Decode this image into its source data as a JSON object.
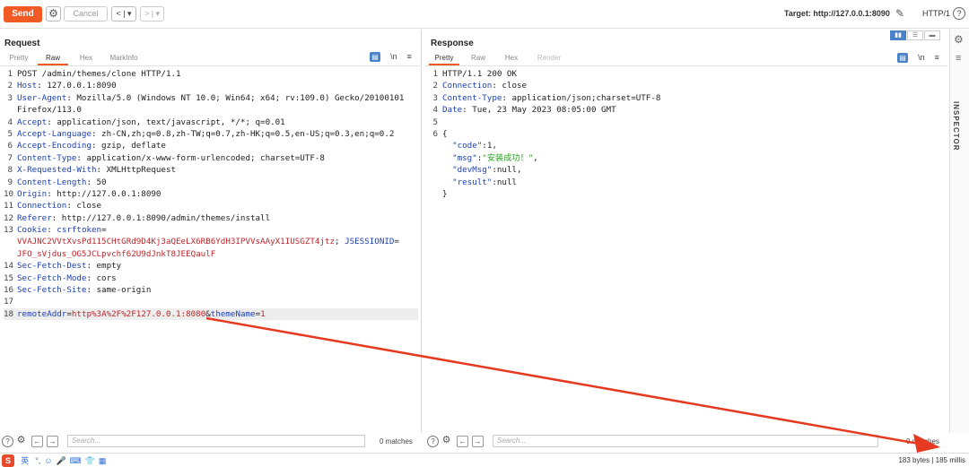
{
  "toolbar": {
    "send": "Send",
    "cancel": "Cancel",
    "back": "< | ▾",
    "forward": "> | ▾",
    "target": "Target: http://127.0.0.1:8090",
    "protocol": "HTTP/1",
    "help": "?",
    "gear": "⚙",
    "edit": "✎"
  },
  "request": {
    "title": "Request",
    "tabs": [
      "Pretty",
      "Raw",
      "Hex",
      "MarkInfo"
    ],
    "active_tab": "Raw",
    "tools": [
      "\\n",
      "≡"
    ],
    "lines": [
      {
        "n": "1",
        "parts": [
          [
            "v",
            "POST /admin/themes/clone HTTP/1.1"
          ]
        ]
      },
      {
        "n": "2",
        "parts": [
          [
            "k",
            "Host"
          ],
          [
            "v",
            ": 127.0.0.1:8090"
          ]
        ]
      },
      {
        "n": "3",
        "parts": [
          [
            "k",
            "User-Agent"
          ],
          [
            "v",
            ": Mozilla/5.0 (Windows NT 10.0; Win64; x64; rv:109.0) Gecko/20100101"
          ]
        ]
      },
      {
        "n": "",
        "parts": [
          [
            "v",
            "Firefox/113.0"
          ]
        ]
      },
      {
        "n": "4",
        "parts": [
          [
            "k",
            "Accept"
          ],
          [
            "v",
            ": application/json, text/javascript, */*; q=0.01"
          ]
        ]
      },
      {
        "n": "5",
        "parts": [
          [
            "k",
            "Accept-Language"
          ],
          [
            "v",
            ": zh-CN,zh;q=0.8,zh-TW;q=0.7,zh-HK;q=0.5,en-US;q=0.3,en;q=0.2"
          ]
        ]
      },
      {
        "n": "6",
        "parts": [
          [
            "k",
            "Accept-Encoding"
          ],
          [
            "v",
            ": gzip, deflate"
          ]
        ]
      },
      {
        "n": "7",
        "parts": [
          [
            "k",
            "Content-Type"
          ],
          [
            "v",
            ": application/x-www-form-urlencoded; charset=UTF-8"
          ]
        ]
      },
      {
        "n": "8",
        "parts": [
          [
            "k",
            "X-Requested-With"
          ],
          [
            "v",
            ": XMLHttpRequest"
          ]
        ]
      },
      {
        "n": "9",
        "parts": [
          [
            "k",
            "Content-Length"
          ],
          [
            "v",
            ": 50"
          ]
        ]
      },
      {
        "n": "10",
        "parts": [
          [
            "k",
            "Origin"
          ],
          [
            "v",
            ": http://127.0.0.1:8090"
          ]
        ]
      },
      {
        "n": "11",
        "parts": [
          [
            "k",
            "Connection"
          ],
          [
            "v",
            ": close"
          ]
        ]
      },
      {
        "n": "12",
        "parts": [
          [
            "k",
            "Referer"
          ],
          [
            "v",
            ": http://127.0.0.1:8090/admin/themes/install"
          ]
        ]
      },
      {
        "n": "13",
        "parts": [
          [
            "k",
            "Cookie"
          ],
          [
            "v",
            ": "
          ],
          [
            "k",
            "csrftoken"
          ],
          [
            "v",
            "="
          ]
        ]
      },
      {
        "n": "",
        "parts": [
          [
            "r",
            "VVAJNC2VVtXvsPd115CHtGRd9D4Kj3aQEeLX6RB6YdH3IPVVsAAyX1IUSGZT4jtz"
          ],
          [
            "v",
            "; "
          ],
          [
            "k",
            "JSESSIONID"
          ],
          [
            "v",
            "="
          ]
        ]
      },
      {
        "n": "",
        "parts": [
          [
            "r",
            "JFO_sVjdus_OG5JCLpvchf62U9dJnkT8JEEQaulF"
          ]
        ]
      },
      {
        "n": "14",
        "parts": [
          [
            "k",
            "Sec-Fetch-Dest"
          ],
          [
            "v",
            ": empty"
          ]
        ]
      },
      {
        "n": "15",
        "parts": [
          [
            "k",
            "Sec-Fetch-Mode"
          ],
          [
            "v",
            ": cors"
          ]
        ]
      },
      {
        "n": "16",
        "parts": [
          [
            "k",
            "Sec-Fetch-Site"
          ],
          [
            "v",
            ": same-origin"
          ]
        ]
      },
      {
        "n": "17",
        "parts": []
      },
      {
        "n": "18",
        "parts": [
          [
            "k",
            "remoteAddr"
          ],
          [
            "v",
            "="
          ],
          [
            "r",
            "http%3A%2F%2F127.0.0.1:8080"
          ],
          [
            "v",
            "&"
          ],
          [
            "k",
            "themeName"
          ],
          [
            "v",
            "="
          ],
          [
            "r",
            "1"
          ]
        ],
        "highlight": true
      }
    ],
    "search_placeholder": "Search...",
    "matches": "0 matches"
  },
  "response": {
    "title": "Response",
    "tabs": [
      "Pretty",
      "Raw",
      "Hex",
      "Render"
    ],
    "active_tab": "Pretty",
    "tools": [
      "\\n",
      "≡"
    ],
    "lines": [
      {
        "n": "1",
        "parts": [
          [
            "v",
            "HTTP/1.1 200 OK"
          ]
        ]
      },
      {
        "n": "2",
        "parts": [
          [
            "k",
            "Connection"
          ],
          [
            "v",
            ": close"
          ]
        ]
      },
      {
        "n": "3",
        "parts": [
          [
            "k",
            "Content-Type"
          ],
          [
            "v",
            ": application/json;charset=UTF-8"
          ]
        ]
      },
      {
        "n": "4",
        "parts": [
          [
            "k",
            "Date"
          ],
          [
            "v",
            ": Tue, 23 May 2023 08:05:00 GMT"
          ]
        ]
      },
      {
        "n": "5",
        "parts": []
      },
      {
        "n": "6",
        "parts": [
          [
            "v",
            "{"
          ]
        ]
      },
      {
        "n": "",
        "parts": [
          [
            "v",
            "  "
          ],
          [
            "k",
            "\"code\""
          ],
          [
            "v",
            ":1,"
          ]
        ]
      },
      {
        "n": "",
        "parts": [
          [
            "v",
            "  "
          ],
          [
            "k",
            "\"msg\""
          ],
          [
            "v",
            ":"
          ],
          [
            "g",
            "\"安装成功！\""
          ],
          [
            "v",
            ","
          ]
        ]
      },
      {
        "n": "",
        "parts": [
          [
            "v",
            "  "
          ],
          [
            "k",
            "\"devMsg\""
          ],
          [
            "v",
            ":null,"
          ]
        ]
      },
      {
        "n": "",
        "parts": [
          [
            "v",
            "  "
          ],
          [
            "k",
            "\"result\""
          ],
          [
            "v",
            ":null"
          ]
        ]
      },
      {
        "n": "",
        "parts": [
          [
            "v",
            "}"
          ]
        ]
      }
    ],
    "search_placeholder": "Search...",
    "matches": "0 matches"
  },
  "inspector": {
    "label": "INSPECTOR"
  },
  "status": {
    "text": "183 bytes | 185 millis"
  },
  "ime": {
    "logo": "S",
    "lang": "英",
    "items": [
      "°,",
      "☺",
      "🎤",
      "⌨",
      "👕",
      "▦"
    ]
  },
  "colors": {
    "accent": "#f15a22",
    "key": "#1b3fb5",
    "value_red": "#c0242a",
    "string_green": "#2a9d22",
    "arrow": "#e53920"
  }
}
